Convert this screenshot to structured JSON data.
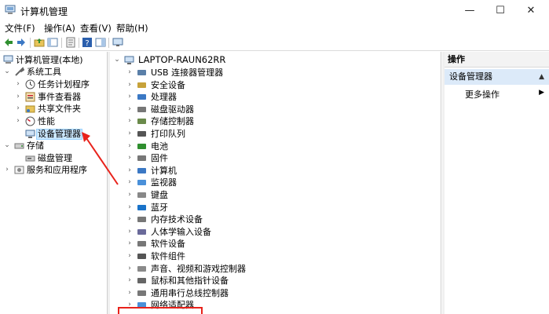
{
  "window": {
    "title": "计算机管理",
    "minimize_icon": "—",
    "maximize_icon": "☐",
    "close_icon": "✕"
  },
  "menu": {
    "items": [
      "文件(F)",
      "操作(A)",
      "查看(V)",
      "帮助(H)"
    ]
  },
  "left_tree": {
    "root": "计算机管理(本地)",
    "system_tools": "系统工具",
    "task_scheduler": "任务计划程序",
    "event_viewer": "事件查看器",
    "shared_folders": "共享文件夹",
    "performance": "性能",
    "device_manager": "设备管理器",
    "storage": "存储",
    "disk_management": "磁盘管理",
    "services_apps": "服务和应用程序"
  },
  "device_tree": {
    "computer_name": "LAPTOP-RAUN62RR",
    "categories": [
      "USB 连接器管理器",
      "安全设备",
      "处理器",
      "磁盘驱动器",
      "存储控制器",
      "打印队列",
      "电池",
      "固件",
      "计算机",
      "监视器",
      "键盘",
      "蓝牙",
      "内存技术设备",
      "人体学输入设备",
      "软件设备",
      "软件组件",
      "声音、视频和游戏控制器",
      "鼠标和其他指针设备",
      "通用串行总线控制器",
      "网络适配器"
    ]
  },
  "actions": {
    "header": "操作",
    "section": "设备管理器",
    "more": "更多操作"
  },
  "colors": {
    "selection": "#cce8ff",
    "annotation_red": "#e8221b",
    "action_section": "#dceaf9"
  }
}
